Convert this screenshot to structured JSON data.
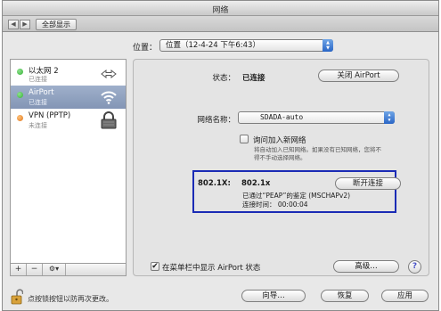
{
  "window": {
    "title": "网络"
  },
  "toolbar": {
    "back": "◀",
    "forward": "▶",
    "show_all": "全部显示"
  },
  "location": {
    "label": "位置：",
    "value": "位置（12-4-24 下午6:43）"
  },
  "services": [
    {
      "name": "以太网 2",
      "status": "已连接",
      "dot_color": "#35b335",
      "icon": "ethernet-arrows-icon"
    },
    {
      "name": "AirPort",
      "status": "已连接",
      "dot_color": "#35b335",
      "icon": "wifi-icon",
      "selected": true
    },
    {
      "name": "VPN (PPTP)",
      "status": "未连接",
      "dot_color": "#e0781e",
      "icon": "vpn-lock-icon"
    }
  ],
  "sidebar_buttons": {
    "add": "+",
    "remove": "−",
    "action": "⚙▾"
  },
  "details": {
    "status_label": "状态：",
    "status_value": "已连接",
    "turn_off_button": "关闭 AirPort",
    "network_name_label": "网络名称：",
    "network_name_value": "SDADA-auto",
    "ask_join_label": "询问加入新网络",
    "ask_join_note_1": "将自动加入已知网络。如果没有已知网络，您将不",
    "ask_join_note_2": "得不手动选择网络。"
  },
  "auth": {
    "label": "802.1X:",
    "value": "802.1x",
    "disconnect_button": "断开连接",
    "line1": "已通过“PEAP”的鉴定 (MSCHAPv2)",
    "line2": "连接时间：  00:00:04"
  },
  "bottom": {
    "show_in_menubar_label": "在菜单栏中显示 AirPort 状态",
    "advanced_button": "高级…",
    "help_button": "?",
    "lock_text": "点按锁按钮以防再次更改。",
    "assist_button": "向导…",
    "revert_button": "恢复",
    "apply_button": "应用"
  },
  "colors": {
    "highlight_box": "#1a2bb5",
    "selected_row": "#8ea0c0",
    "connected": "#35b335",
    "disconnected": "#e0781e"
  }
}
